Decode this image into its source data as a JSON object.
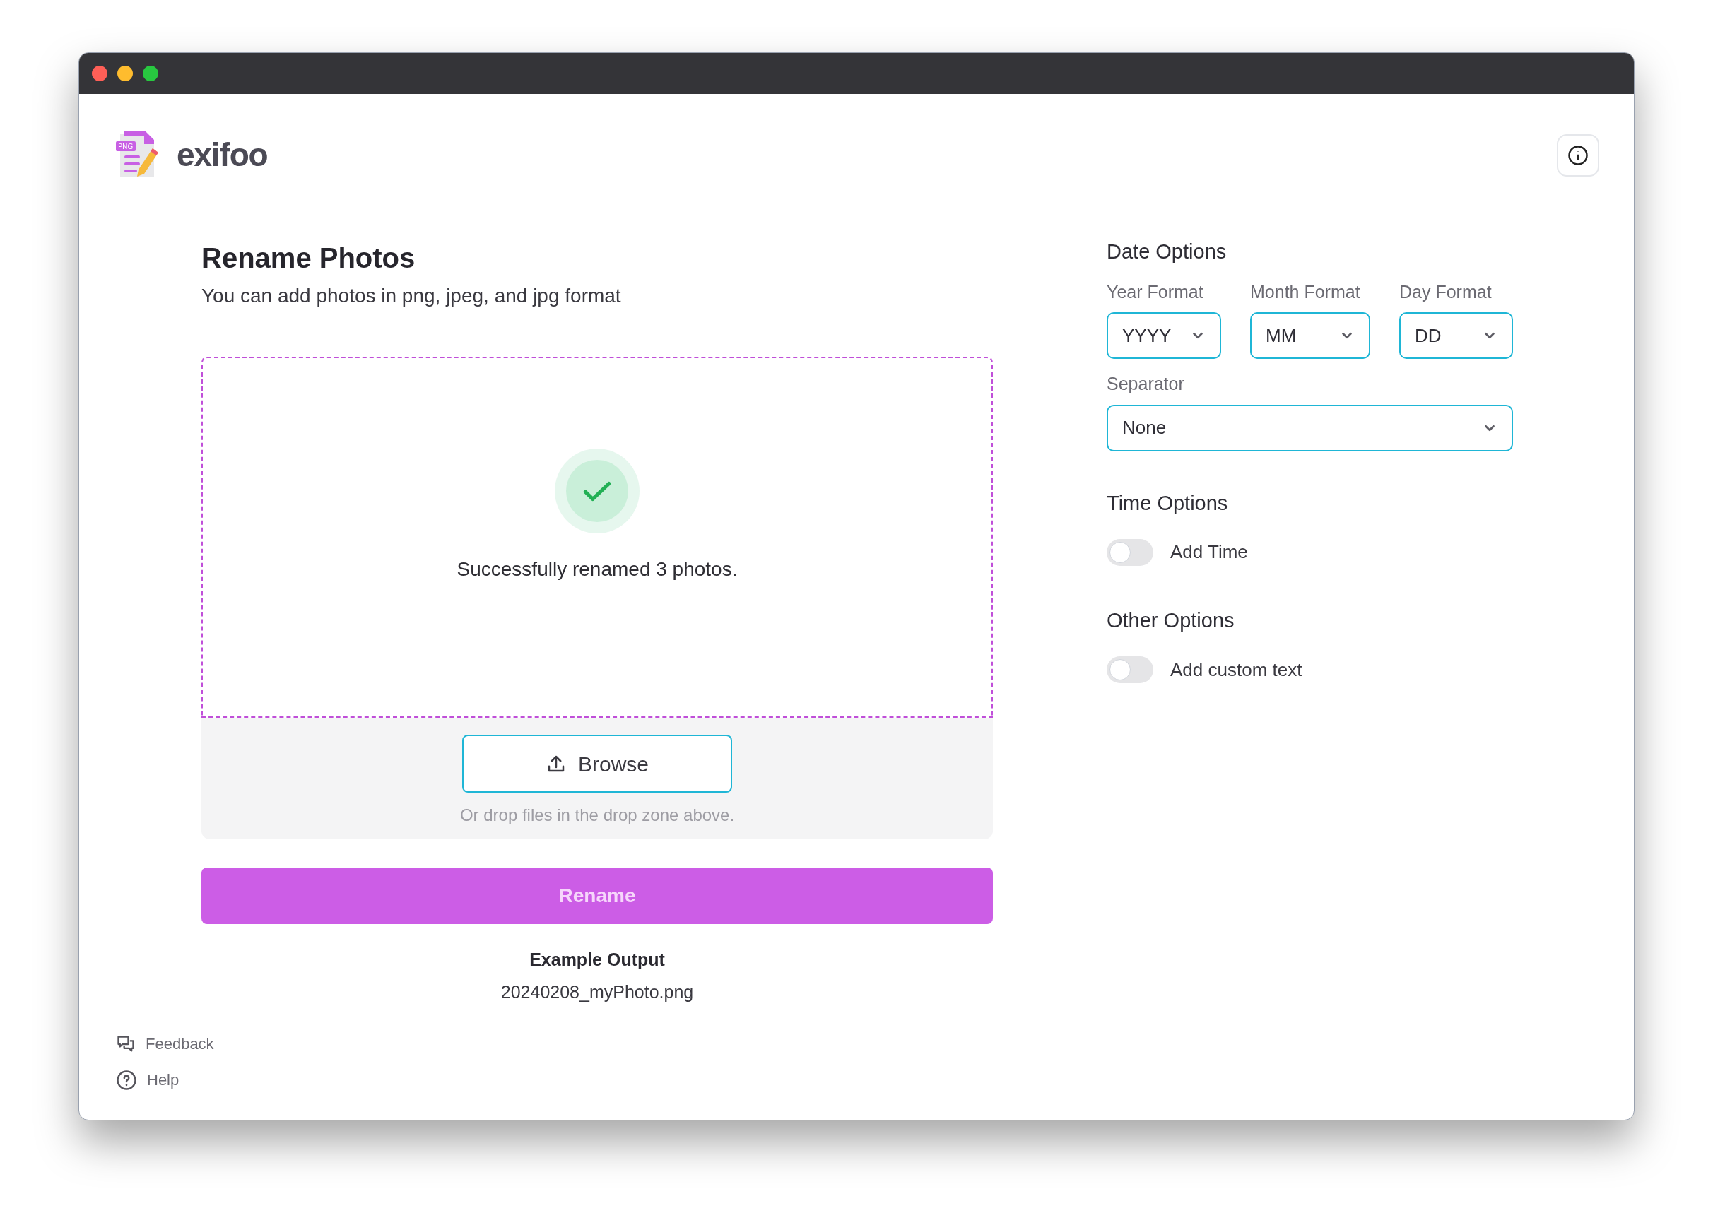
{
  "app": {
    "name": "exifoo",
    "logo_badge": "PNG"
  },
  "main": {
    "title": "Rename Photos",
    "subtitle": "You can add photos in png, jpeg, and jpg format",
    "drop_zone": {
      "message": "Successfully renamed 3 photos."
    },
    "browse_button": "Browse",
    "drop_hint": "Or drop files in the drop zone above.",
    "rename_button": "Rename",
    "example": {
      "label": "Example Output",
      "value": "20240208_myPhoto.png"
    }
  },
  "date_options": {
    "title": "Date Options",
    "selects": [
      {
        "label": "Year Format",
        "value": "YYYY"
      },
      {
        "label": "Month Format",
        "value": "MM"
      },
      {
        "label": "Day Format",
        "value": "DD"
      }
    ],
    "separator": {
      "label": "Separator",
      "value": "None"
    }
  },
  "time_options": {
    "title": "Time Options",
    "toggle": {
      "label": "Add Time",
      "on": false
    }
  },
  "other_options": {
    "title": "Other Options",
    "toggle": {
      "label": "Add custom text",
      "on": false
    }
  },
  "footer_links": [
    {
      "kind": "feedback",
      "label": "Feedback"
    },
    {
      "kind": "help",
      "label": "Help"
    }
  ]
}
